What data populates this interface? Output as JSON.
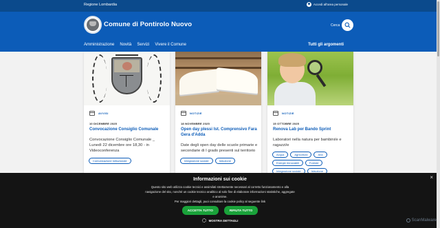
{
  "topbar": {
    "region": "Regione Lombardia",
    "login": "Accedi all'area personale"
  },
  "header": {
    "title": "Comune di Pontirolo Nuovo",
    "search_label": "Cerca",
    "nav": [
      "Amministrazione",
      "Novità",
      "Servizi",
      "Vivere il Comune"
    ],
    "all_topics": "Tutti gli argomenti"
  },
  "cards": [
    {
      "category": "AVVISI",
      "date": "10 DICEMBRE 2025",
      "title": "Convocazione Consiglio Comunale",
      "desc": "Convocazione Consiglio Comunale _ Lunedì 22 dicembre ore 18,30 - in Videoconferenza",
      "tags": [
        "Comunicazione istituzionale"
      ]
    },
    {
      "category": "NOTIZIE",
      "date": "18 NOVEMBRE 2025",
      "title": "Open day plessi Ist. Comprensivo Fara Gera d'Adda",
      "desc": "Date degli open day delle scuole primarie e secondarie di I grado presenti sul territorio",
      "tags": [
        "Integrazione sociale",
        "Istruzione"
      ]
    },
    {
      "category": "NOTIZIE",
      "date": "15 OTTOBRE 2025",
      "title": "Renova Lab per Bando Sprint",
      "desc": "Laboratori nella natura per bambini/e e ragazzi/e",
      "tags": [
        "Acqua",
        "Agricoltura",
        "Aria",
        "Energie rinnovabili",
        "Foreste",
        "Integrazione sociale",
        "Istruzione"
      ]
    }
  ],
  "cookie": {
    "title": "Informazioni sui cookie",
    "text": "Questo sito web utilizza cookie tecnici e assimilati strettamente necessari al corretto funzionamento e alla navigazione del sito, nonché un cookie tecnico analitico al solo fine di elaborare informazioni statistiche, aggregate e anonime.",
    "text2": "Per maggiori dettagli, puoi consultare la cookie policy al seguente link",
    "accept": "ACCETTA TUTTO",
    "reject": "RIFIUTA TUTTO",
    "details": "MOSTRA DETTAGLI",
    "close": "×",
    "brand": "ScanMalware"
  },
  "colors": {
    "primary": "#0c5cb8",
    "topbar": "#0b4a8c",
    "cookie_bg": "#141414",
    "button": "#1aa23a"
  }
}
